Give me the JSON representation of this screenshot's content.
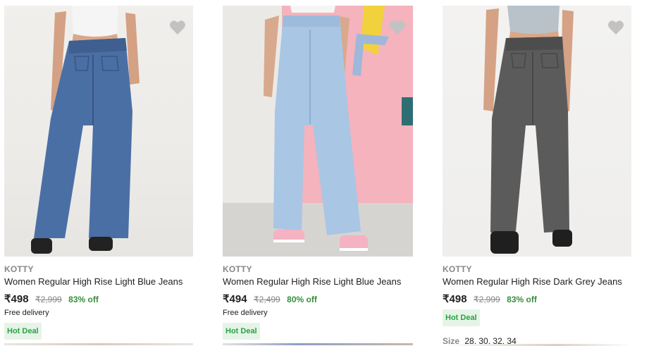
{
  "products": [
    {
      "brand": "KOTTY",
      "title": "Women Regular High Rise Light Blue Jeans",
      "price": "₹498",
      "mrp": "₹2,999",
      "discount": "83% off",
      "delivery": "Free delivery",
      "badge": "Hot Deal",
      "jeans_color": "#4a6fa5"
    },
    {
      "brand": "KOTTY",
      "title": "Women Regular High Rise Light Blue Jeans",
      "price": "₹494",
      "mrp": "₹2,499",
      "discount": "80% off",
      "delivery": "Free delivery",
      "badge": "Hot Deal",
      "jeans_color": "#a9c6e4"
    },
    {
      "brand": "KOTTY",
      "title": "Women Regular High Rise Dark Grey Jeans",
      "price": "₹498",
      "mrp": "₹2,999",
      "discount": "83% off",
      "badge": "Hot Deal",
      "size_label": "Size",
      "sizes": "28, 30, 32, 34",
      "jeans_color": "#5b5b5b"
    }
  ],
  "colors": {
    "discount_green": "#388e3c",
    "badge_bg": "#e6f4e8",
    "badge_text": "#26a541",
    "muted": "#878787",
    "wishlist_heart": "#c2c2c2"
  }
}
